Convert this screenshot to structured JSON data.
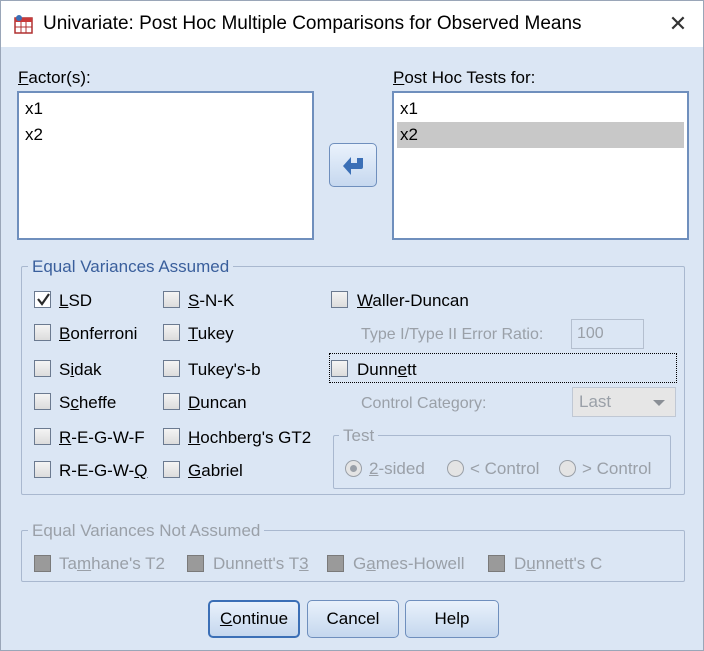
{
  "window": {
    "title": "Univariate: Post Hoc Multiple Comparisons for Observed Means"
  },
  "factors": {
    "label": "Factor(s):",
    "items": [
      "x1",
      "x2"
    ]
  },
  "posthoc": {
    "label": "Post Hoc Tests for:",
    "items": [
      "x1",
      "x2"
    ],
    "selected_index": 1
  },
  "equal": {
    "title": "Equal Variances Assumed",
    "lsd": "LSD",
    "snk": "S-N-K",
    "waller": "Waller-Duncan",
    "bonferroni": "Bonferroni",
    "tukey": "Tukey",
    "ratio_label": "Type I/Type II Error Ratio:",
    "ratio_value": "100",
    "sidak": "Sidak",
    "tukeyb": "Tukey's-b",
    "dunnett": "Dunnett",
    "scheffe": "Scheffe",
    "duncan": "Duncan",
    "control_label": "Control Category:",
    "control_value": "Last",
    "regwf": "R-E-G-W-F",
    "hochberg": "Hochberg's GT2",
    "test_title": "Test",
    "regwq": "R-E-G-W-Q",
    "gabriel": "Gabriel",
    "two_sided": "2-sided",
    "lt_control": "< Control",
    "gt_control": "> Control",
    "checked": {
      "lsd": true
    }
  },
  "unequal": {
    "title": "Equal Variances Not Assumed",
    "tamhane": "Tamhane's T2",
    "dunnett_t3": "Dunnett's T3",
    "games_howell": "Games-Howell",
    "dunnett_c": "Dunnett's C"
  },
  "buttons": {
    "continue": "Continue",
    "cancel": "Cancel",
    "help": "Help"
  }
}
